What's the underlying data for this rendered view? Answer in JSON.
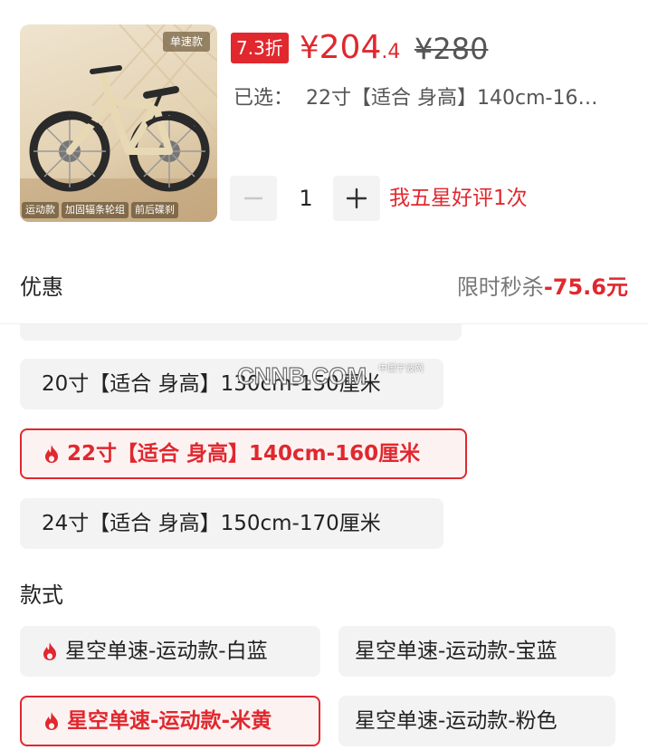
{
  "product": {
    "image": {
      "top_tag": "单速款",
      "bottom_tags": [
        "运动款",
        "加固辐条轮组",
        "前后碟刹"
      ]
    },
    "discount_badge": "7.3折",
    "price": {
      "currency": "¥",
      "integer": "204",
      "decimal": ".4"
    },
    "original_price": "¥280",
    "selected_label": "已选：",
    "selected_value": "22寸【适合 身高】140cm-16…",
    "quantity": "1",
    "review_note": "我五星好评1次"
  },
  "promo": {
    "label": "优惠",
    "type": "限时秒杀",
    "amount": "-75.6元"
  },
  "size_options": [
    {
      "label": "20寸【适合 身高】130cm-150厘米",
      "selected": false,
      "hot": false
    },
    {
      "label": "22寸【适合 身高】140cm-160厘米",
      "selected": true,
      "hot": true
    },
    {
      "label": "24寸【适合 身高】150cm-170厘米",
      "selected": false,
      "hot": false
    }
  ],
  "style_section": {
    "label": "款式",
    "options": [
      {
        "label": "星空单速-运动款-白蓝",
        "selected": false,
        "hot": true
      },
      {
        "label": "星空单速-运动款-宝蓝",
        "selected": false,
        "hot": false
      },
      {
        "label": "星空单速-运动款-米黄",
        "selected": true,
        "hot": true
      },
      {
        "label": "星空单速-运动款-粉色",
        "selected": false,
        "hot": false
      }
    ]
  },
  "watermark": {
    "text": "CNNB.COM",
    "small_text": "中国宁波网"
  },
  "colors": {
    "accent": "#e0282e",
    "chip_bg": "#f3f3f3",
    "selected_bg": "#fdf2f2"
  },
  "icons": [
    "minus-icon",
    "plus-icon",
    "flame-icon"
  ]
}
